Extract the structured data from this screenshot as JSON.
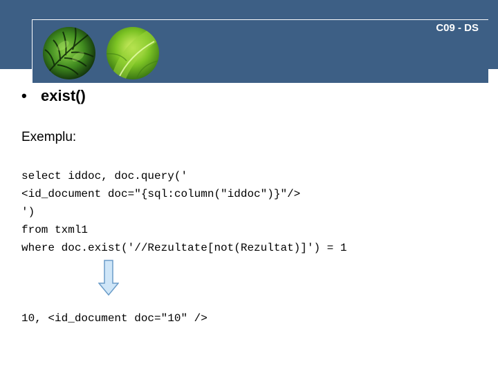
{
  "header": {
    "slide_code": "C09 - DS"
  },
  "bullet": {
    "symbol": "•",
    "text": "exist()"
  },
  "example": {
    "label": "Exemplu:"
  },
  "code": {
    "lines": [
      "select iddoc, doc.query('",
      "<id_document doc=\"{sql:column(\"iddoc\")}\"/>",
      "')",
      "from txml1",
      "where doc.exist('//Rezultate[not(Rezultat)]') = 1"
    ]
  },
  "result": {
    "text": "10, <id_document doc=\"10\" />"
  },
  "icons": {
    "arrow": "down-arrow-icon",
    "images": [
      "fern-leaf-image",
      "green-leaf-image"
    ]
  },
  "colors": {
    "header_background": "#3d5f85",
    "arrow_fill": "#cfe6f8",
    "arrow_stroke": "#6a9cc8"
  }
}
